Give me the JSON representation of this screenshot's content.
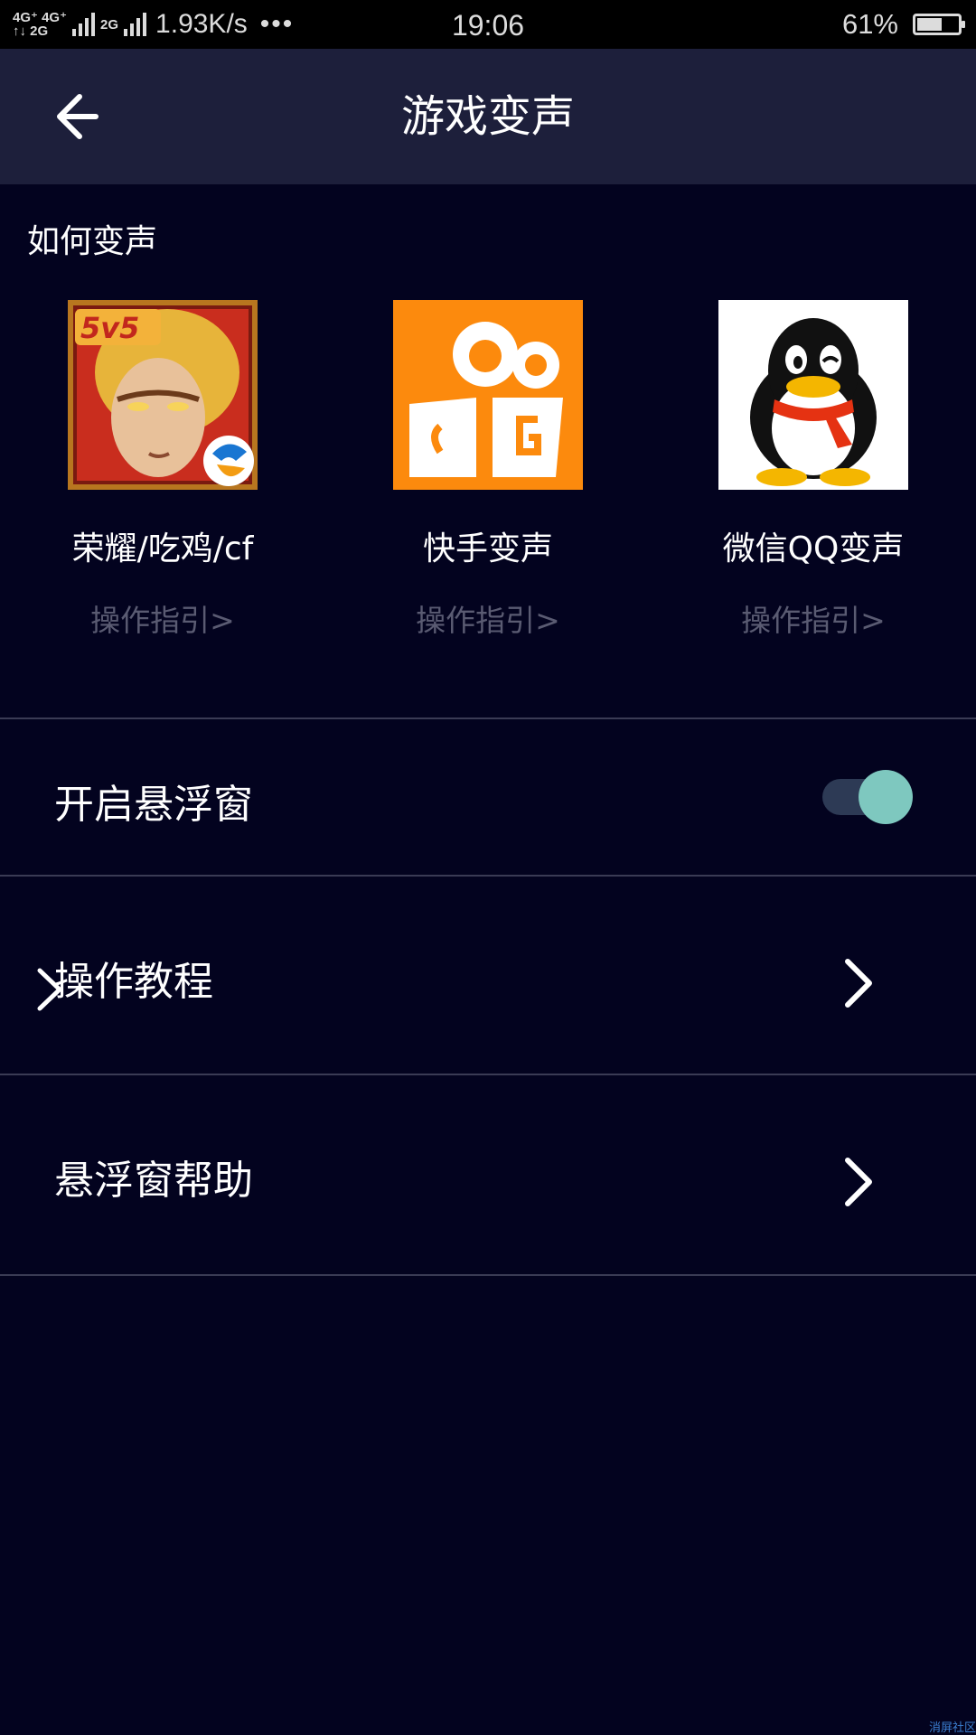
{
  "status_bar": {
    "net_top": "4G⁺ 4G⁺",
    "net_bottom": "↑↓ 2G",
    "net_2g": "2G",
    "speed": "1.93K/s",
    "dots": "•••",
    "time": "19:06",
    "battery_percent": "61%",
    "battery_level": 0.61
  },
  "header": {
    "title": "游戏变声"
  },
  "section": {
    "title": "如何变声"
  },
  "apps": [
    {
      "name": "荣耀/吃鸡/cf",
      "guide": "操作指引>",
      "icon": "king-of-glory-icon"
    },
    {
      "name": "快手变声",
      "guide": "操作指引>",
      "icon": "kuaishou-icon"
    },
    {
      "name": "微信QQ变声",
      "guide": "操作指引>",
      "icon": "qq-penguin-icon"
    }
  ],
  "settings": {
    "floating_window": {
      "label": "开启悬浮窗",
      "enabled": true
    },
    "tutorial": {
      "label": "操作教程"
    },
    "help": {
      "label": "悬浮窗帮助"
    }
  },
  "watermark": "消屏社区",
  "colors": {
    "background": "#03031f",
    "header": "#1d1f3b",
    "toggle_knob": "#7ec8bf",
    "guide_text": "#5a5b72"
  }
}
